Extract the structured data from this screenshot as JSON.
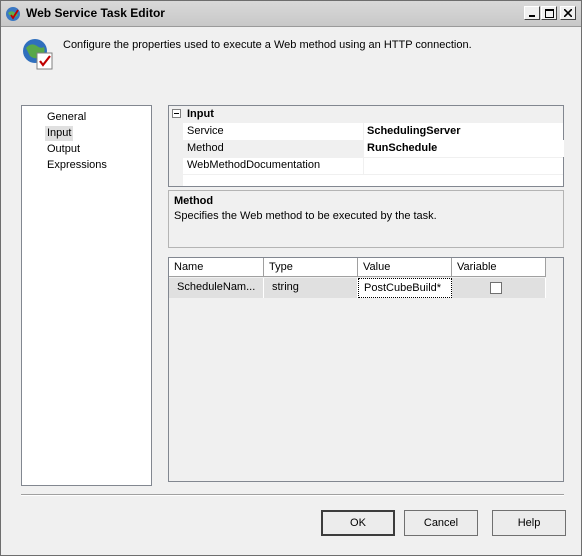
{
  "window": {
    "title": "Web Service Task Editor",
    "controls": {
      "minimize_icon": "minimize-icon",
      "maximize_icon": "maximize-icon",
      "close_icon": "close-icon"
    }
  },
  "header": {
    "icon": "web-service-icon",
    "description": "Configure the properties used to execute a Web method using an HTTP connection."
  },
  "nav": {
    "items": [
      {
        "label": "General"
      },
      {
        "label": "Input",
        "selected": true
      },
      {
        "label": "Output"
      },
      {
        "label": "Expressions"
      }
    ]
  },
  "property_grid": {
    "category": "Input",
    "rows": [
      {
        "name": "Service",
        "value": "SchedulingServer"
      },
      {
        "name": "Method",
        "value": "RunSchedule"
      },
      {
        "name": "WebMethodDocumentation",
        "value": ""
      }
    ]
  },
  "description_panel": {
    "title": "Method",
    "text": "Specifies the Web method to be executed by the task."
  },
  "parameters_grid": {
    "columns": [
      "Name",
      "Type",
      "Value",
      "Variable"
    ],
    "rows": [
      {
        "name": "ScheduleNam...",
        "type": "string",
        "value": "PostCubeBuild*",
        "variable": false
      }
    ]
  },
  "buttons": {
    "ok": "OK",
    "cancel": "Cancel",
    "help": "Help"
  }
}
